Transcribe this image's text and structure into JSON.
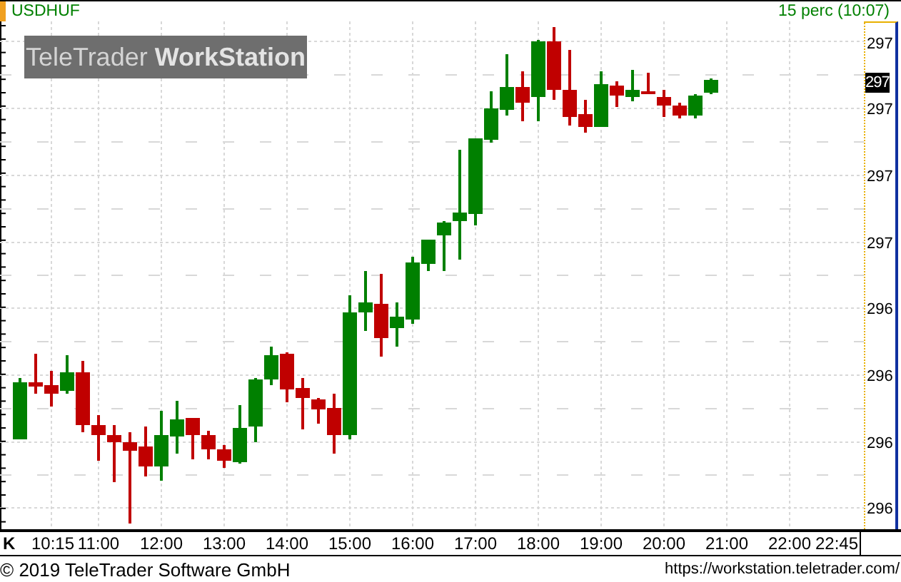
{
  "header": {
    "symbol": "USDHUF",
    "period": "15 perc (10:07)"
  },
  "logo": {
    "text": "TeleTrader **WorkStation**"
  },
  "y_axis": {
    "labels": [
      {
        "text": "297",
        "current": false
      },
      {
        "text": "297",
        "current": true
      },
      {
        "text": "297",
        "current": false
      },
      {
        "text": "297",
        "current": false
      },
      {
        "text": "297",
        "current": false
      },
      {
        "text": "296",
        "current": false
      },
      {
        "text": "296",
        "current": false
      },
      {
        "text": "296",
        "current": false
      },
      {
        "text": "296",
        "current": false
      }
    ]
  },
  "x_axis": {
    "corner": "K",
    "labels": [
      "10:15",
      "11:00",
      "12:00",
      "13:00",
      "14:00",
      "15:00",
      "16:00",
      "17:00",
      "18:00",
      "19:00",
      "20:00",
      "21:00",
      "22:00",
      "22:45"
    ]
  },
  "footer": {
    "copyright": "© 2019 TeleTrader Software GmbH",
    "url": "https://workstation.teletrader.com/"
  }
}
